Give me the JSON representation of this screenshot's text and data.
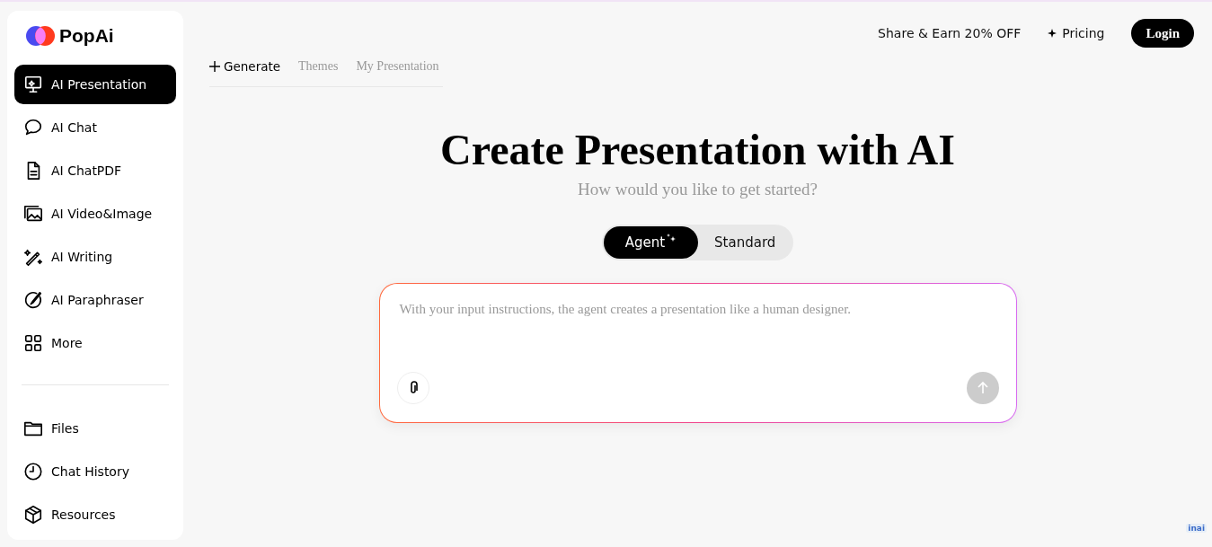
{
  "sidebar": {
    "brand": "PopAi",
    "items": [
      {
        "label": "AI Presentation",
        "kind": "presentation",
        "selected": true
      },
      {
        "label": "AI Chat",
        "kind": "chat",
        "selected": false
      },
      {
        "label": "AI ChatPDF",
        "kind": "doc",
        "selected": false
      },
      {
        "label": "AI Video&Image",
        "kind": "image",
        "selected": false
      },
      {
        "label": "AI Writing",
        "kind": "wand",
        "selected": false
      },
      {
        "label": "AI Paraphraser",
        "kind": "pen",
        "selected": false
      },
      {
        "label": "More",
        "kind": "grid",
        "selected": false
      }
    ],
    "bottom_items": [
      {
        "label": "Files",
        "kind": "folder"
      },
      {
        "label": "Chat History",
        "kind": "clock"
      },
      {
        "label": "Resources",
        "kind": "box"
      }
    ]
  },
  "header": {
    "share": "Share & Earn 20% OFF",
    "pricing": "Pricing",
    "login": "Login"
  },
  "tabs": [
    {
      "label": "Generate",
      "selected": true
    },
    {
      "label": "Themes",
      "selected": false
    },
    {
      "label": "My Presentation",
      "selected": false
    }
  ],
  "title": "Create Presentation with AI",
  "subtitle": "How would you like to get started?",
  "modes": [
    {
      "label": "Agent",
      "selected": true
    },
    {
      "label": "Standard",
      "selected": false
    }
  ],
  "prompt": {
    "placeholder": "With your input instructions, the agent creates a presentation like a human designer."
  },
  "corner_badge": "inai"
}
